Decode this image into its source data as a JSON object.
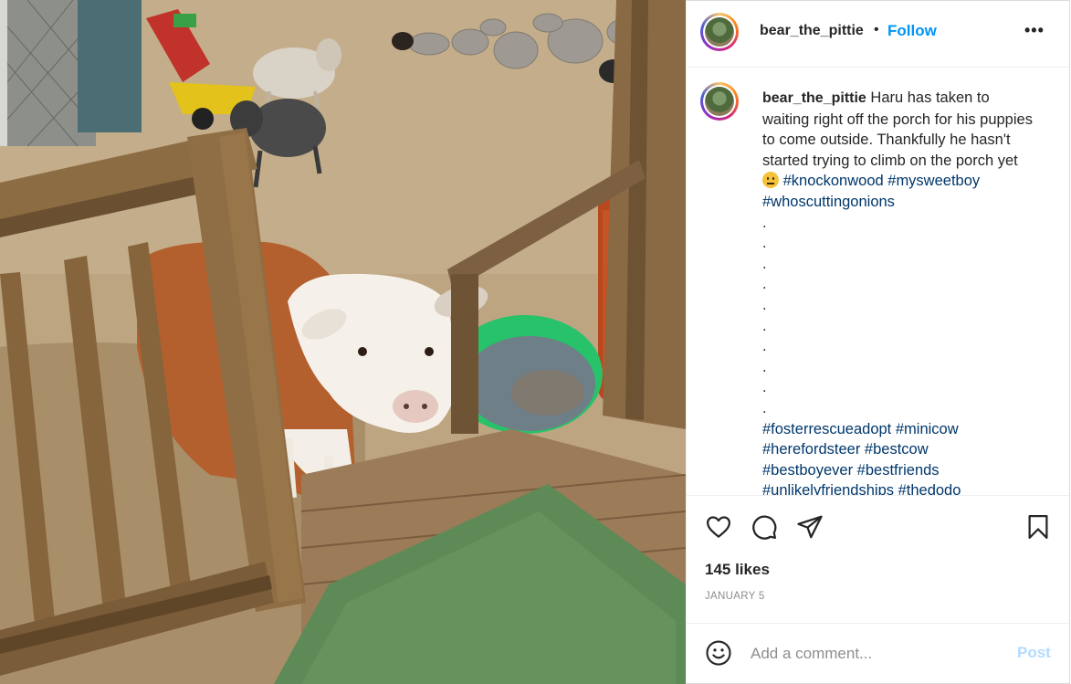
{
  "post": {
    "photo_alt": "",
    "username": "bear_the_pittie",
    "separator": "•",
    "follow_label": "Follow",
    "more_label": "•••",
    "caption": {
      "username": "bear_the_pittie",
      "text": "Haru has taken to waiting right off the porch for his puppies to come outside. Thankfully he hasn't started trying to climb on the porch yet",
      "emoji": "neutral-face-emoji",
      "inline_tags": [
        "#knockonwood",
        "#mysweetboy",
        "#whoscuttingonions"
      ],
      "dots": [
        ".",
        ".",
        ".",
        ".",
        ".",
        ".",
        ".",
        ".",
        ".",
        "."
      ],
      "tag_lines": [
        [
          "#fosterrescueadopt",
          "#minicow"
        ],
        [
          "#herefordsteer",
          "#bestcow"
        ],
        [
          "#bestboyever",
          "#bestfriends"
        ],
        [
          "#unlikelyfriendships",
          "#thedodo"
        ]
      ]
    },
    "icons": {
      "like": "heart-icon",
      "comment": "comment-bubble-icon",
      "share": "paper-plane-icon",
      "save": "bookmark-icon",
      "emoji": "smiley-face-icon"
    },
    "likes": "145 likes",
    "date": "JANUARY 5",
    "comment_placeholder": "Add a comment...",
    "post_label": "Post",
    "colors": {
      "follow": "#0095f6",
      "hashtag": "#00376b",
      "post_disabled": "#b3dbff",
      "muted": "#8e8e8e"
    }
  }
}
